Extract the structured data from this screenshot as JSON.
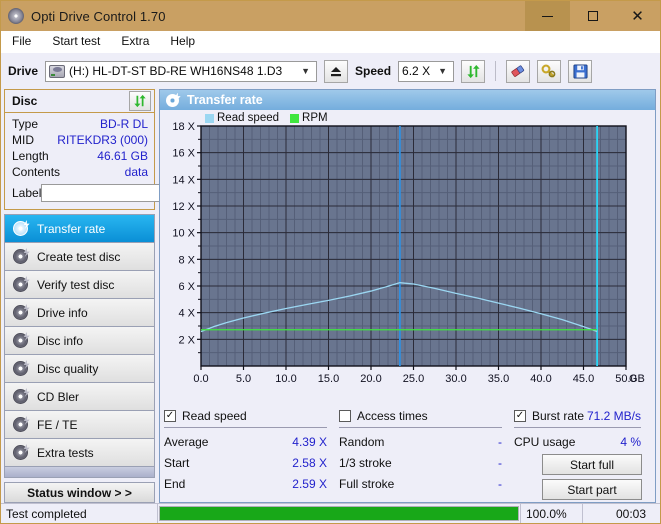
{
  "window": {
    "title": "Opti Drive Control 1.70",
    "app_icon": "disc-icon",
    "minimize": "–",
    "maximize": "□",
    "close": "✕"
  },
  "menu": {
    "items": [
      {
        "label": "File"
      },
      {
        "label": "Start test"
      },
      {
        "label": "Extra"
      },
      {
        "label": "Help"
      }
    ]
  },
  "toolbar": {
    "drive_label": "Drive",
    "drive_value": "(H:)  HL-DT-ST BD-RE  WH16NS48 1.D3",
    "eject_icon": "eject-icon",
    "speed_label": "Speed",
    "speed_value": "6.2 X",
    "refresh_icon": "refresh-icon",
    "erase_icon": "eraser-icon",
    "key_icon": "key-icon",
    "save_icon": "save-icon",
    "dropdown_icon": "chevron-down-icon"
  },
  "disc": {
    "header": "Disc",
    "refresh_icon": "refresh-icon",
    "rows": [
      {
        "key": "Type",
        "value": "BD-R DL"
      },
      {
        "key": "MID",
        "value": "RITEKDR3 (000)"
      },
      {
        "key": "Length",
        "value": "46.61 GB"
      },
      {
        "key": "Contents",
        "value": "data"
      }
    ],
    "label_key": "Label",
    "label_value": "",
    "label_placeholder": "",
    "disc_button_icon": "cd-icon"
  },
  "sidebar": {
    "items": [
      {
        "label": "Transfer rate",
        "icon": "disc-icon",
        "active": true
      },
      {
        "label": "Create test disc",
        "icon": "disc-icon",
        "active": false
      },
      {
        "label": "Verify test disc",
        "icon": "disc-icon",
        "active": false
      },
      {
        "label": "Drive info",
        "icon": "disc-icon",
        "active": false
      },
      {
        "label": "Disc info",
        "icon": "disc-icon",
        "active": false
      },
      {
        "label": "Disc quality",
        "icon": "disc-icon",
        "active": false
      },
      {
        "label": "CD Bler",
        "icon": "disc-icon",
        "active": false
      },
      {
        "label": "FE / TE",
        "icon": "disc-icon",
        "active": false
      },
      {
        "label": "Extra tests",
        "icon": "disc-icon",
        "active": false
      }
    ],
    "status_window": "Status window > >"
  },
  "panel": {
    "title": "Transfer rate",
    "icon": "disc-icon"
  },
  "chart_data": {
    "type": "line",
    "title": "Transfer rate",
    "xlabel": "GB",
    "ylabel": "",
    "xlim": [
      0,
      50
    ],
    "ylim": [
      0,
      18
    ],
    "xticks": [
      "0.0",
      "5.0",
      "10.0",
      "15.0",
      "20.0",
      "25.0",
      "30.0",
      "35.0",
      "40.0",
      "45.0",
      "50.0"
    ],
    "xtick_values": [
      0,
      5,
      10,
      15,
      20,
      25,
      30,
      35,
      40,
      45,
      50
    ],
    "x_unit_label": "GB",
    "yticks": [
      "2 X",
      "4 X",
      "6 X",
      "8 X",
      "10 X",
      "12 X",
      "14 X",
      "16 X",
      "18 X"
    ],
    "ytick_values": [
      2,
      4,
      6,
      8,
      10,
      12,
      14,
      16,
      18
    ],
    "grid": true,
    "plot_bg": "#69758f",
    "grid_color": "#2b2b38",
    "legend": [
      {
        "label": "Read speed",
        "color": "#9bd7f2"
      },
      {
        "label": "RPM",
        "color": "#3ee63e"
      }
    ],
    "legend_position": "top-left",
    "markers": [
      {
        "x": 23.4,
        "color": "#2f8fe0"
      },
      {
        "x": 46.6,
        "color": "#2ad4f5"
      }
    ],
    "series": [
      {
        "name": "Read speed",
        "color": "#9bd7f2",
        "x": [
          0.0,
          1.5,
          3.0,
          5.0,
          7.5,
          10.0,
          12.5,
          15.0,
          17.5,
          20.0,
          22.0,
          23.4,
          25.0,
          27.5,
          30.0,
          32.5,
          35.0,
          37.5,
          40.0,
          42.5,
          45.0,
          46.6
        ],
        "values": [
          2.58,
          2.95,
          3.25,
          3.6,
          3.97,
          4.31,
          4.62,
          4.92,
          5.25,
          5.62,
          5.98,
          6.25,
          6.15,
          5.82,
          5.45,
          5.1,
          4.72,
          4.33,
          3.92,
          3.48,
          2.95,
          2.59
        ]
      },
      {
        "name": "RPM",
        "color": "#3ee63e",
        "x": [
          0.0,
          10.0,
          20.0,
          30.0,
          40.0,
          46.6
        ],
        "values": [
          2.72,
          2.72,
          2.72,
          2.72,
          2.72,
          2.72
        ]
      }
    ]
  },
  "results": {
    "read_speed": {
      "checkbox_label": "Read speed",
      "checked": true,
      "rows": [
        {
          "key": "Average",
          "value": "4.39 X"
        },
        {
          "key": "Start",
          "value": "2.58 X"
        },
        {
          "key": "End",
          "value": "2.59 X"
        }
      ]
    },
    "access_times": {
      "checkbox_label": "Access times",
      "checked": false,
      "rows": [
        {
          "key": "Random",
          "value": "-"
        },
        {
          "key": "1/3 stroke",
          "value": "-"
        },
        {
          "key": "Full stroke",
          "value": "-"
        }
      ]
    },
    "burst_rate": {
      "checkbox_label": "Burst rate",
      "checked": true,
      "value": "71.2 MB/s",
      "rows": [
        {
          "key": "CPU usage",
          "value": "4 %"
        }
      ]
    },
    "buttons": [
      {
        "label": "Start full"
      },
      {
        "label": "Start part"
      }
    ]
  },
  "statusbar": {
    "text": "Test completed",
    "progress_percent": 100.0,
    "progress_label": "100.0%",
    "elapsed": "00:03"
  }
}
